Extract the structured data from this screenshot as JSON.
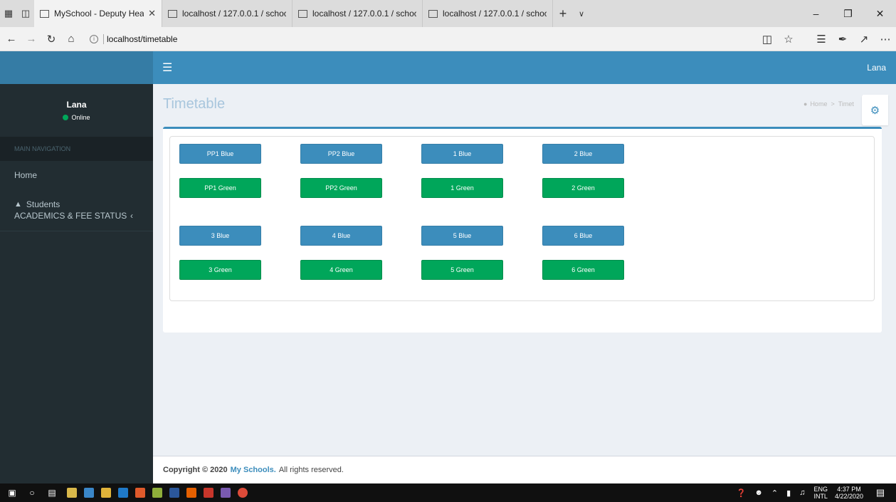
{
  "browser": {
    "active_tab": "MySchool - Deputy Hea",
    "tabs": [
      "localhost / 127.0.0.1 / schoc",
      "localhost / 127.0.0.1 / schoc",
      "localhost / 127.0.0.1 / schoc"
    ],
    "url": "localhost/timetable"
  },
  "header": {
    "username": "Lana"
  },
  "sidebar": {
    "user_name": "Lana",
    "status": "Online",
    "nav_header": "MAIN NAVIGATION",
    "home": "Home",
    "students": "Students",
    "academics": "ACADEMICS & FEE STATUS"
  },
  "content": {
    "title": "Timetable",
    "breadcrumb_home": "Home",
    "breadcrumb_current": "Timetable",
    "buttons": {
      "pp1_blue": "PP1 Blue",
      "pp2_blue": "PP2 Blue",
      "g1_blue": "1 Blue",
      "g2_blue": "2 Blue",
      "pp1_green": "PP1 Green",
      "pp2_green": "PP2 Green",
      "g1_green": "1 Green",
      "g2_green": "2 Green",
      "g3_blue": "3 Blue",
      "g4_blue": "4 Blue",
      "g5_blue": "5 Blue",
      "g6_blue": "6 Blue",
      "g3_green": "3 Green",
      "g4_green": "4 Green",
      "g5_green": "5 Green",
      "g6_green": "6 Green"
    }
  },
  "footer": {
    "copyright": "Copyright © 2020",
    "brand": "My Schools.",
    "rest": "All rights reserved."
  },
  "taskbar": {
    "lang_top": "ENG",
    "lang_bottom": "INTL",
    "time": "4:37 PM",
    "date": "4/22/2020"
  },
  "colors": {
    "primary": "#3c8dbc",
    "success": "#00a65a",
    "sidebar": "#222d32"
  }
}
